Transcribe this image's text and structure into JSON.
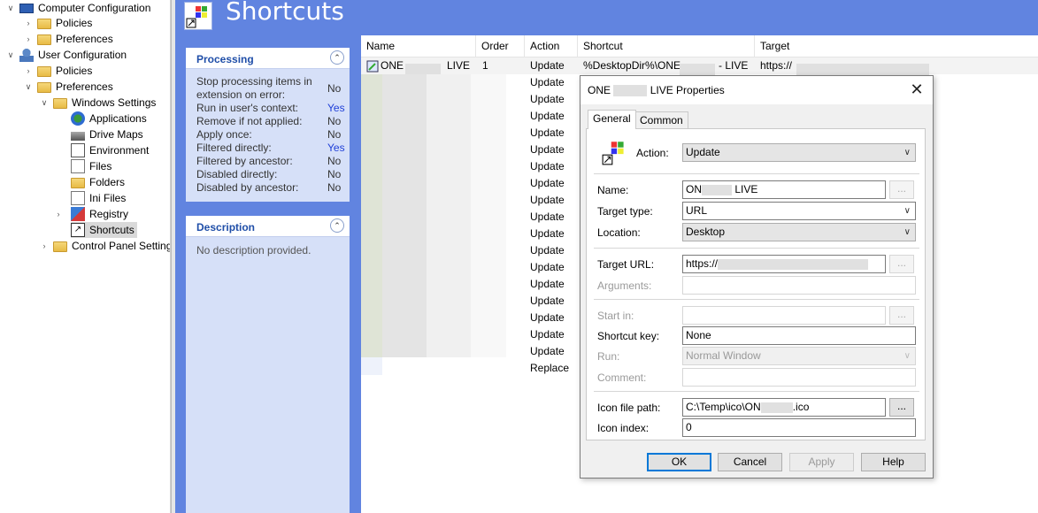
{
  "tree": {
    "computer_configuration": "Computer Configuration",
    "cc_policies": "Policies",
    "cc_preferences": "Preferences",
    "user_configuration": "User Configuration",
    "uc_policies": "Policies",
    "uc_preferences": "Preferences",
    "windows_settings": "Windows Settings",
    "applications": "Applications",
    "drive_maps": "Drive Maps",
    "environment": "Environment",
    "files": "Files",
    "folders": "Folders",
    "ini_files": "Ini Files",
    "registry": "Registry",
    "shortcuts": "Shortcuts",
    "control_panel_settings": "Control Panel Setting"
  },
  "header": {
    "title": "Shortcuts"
  },
  "processing": {
    "title": "Processing",
    "rows": [
      {
        "k": "Stop processing items in",
        "v": ""
      },
      {
        "k": "extension on error:",
        "v": "No"
      },
      {
        "k": "Run in user's context:",
        "v": "Yes"
      },
      {
        "k": "Remove if not applied:",
        "v": "No"
      },
      {
        "k": "Apply once:",
        "v": "No"
      },
      {
        "k": "Filtered directly:",
        "v": "Yes"
      },
      {
        "k": "Filtered by ancestor:",
        "v": "No"
      },
      {
        "k": "Disabled directly:",
        "v": "No"
      },
      {
        "k": "Disabled by ancestor:",
        "v": "No"
      }
    ]
  },
  "description": {
    "title": "Description",
    "text": "No description provided."
  },
  "list": {
    "columns": {
      "name": "Name",
      "order": "Order",
      "action": "Action",
      "shortcut": "Shortcut",
      "target": "Target"
    },
    "first_row": {
      "name_prefix": "ONE",
      "name_suffix": "LIVE",
      "order": "1",
      "action": "Update",
      "shortcut_prefix": "%DesktopDir%\\ONE",
      "shortcut_suffix": "- LIVE",
      "target": "https://"
    },
    "actions": [
      "Update",
      "Update",
      "Update",
      "Update",
      "Update",
      "Update",
      "Update",
      "Update",
      "Update",
      "Update",
      "Update",
      "Update",
      "Update",
      "Update",
      "Update",
      "Update",
      "Update",
      "Replace"
    ]
  },
  "dialog": {
    "title_prefix": "ONE",
    "title_suffix": "LIVE Properties",
    "tabs": {
      "general": "General",
      "common": "Common"
    },
    "action_label": "Action:",
    "action_value": "Update",
    "name_label": "Name:",
    "name_prefix": "ON",
    "name_suffix": "LIVE",
    "target_type_label": "Target type:",
    "target_type_value": "URL",
    "location_label": "Location:",
    "location_value": "Desktop",
    "target_url_label": "Target URL:",
    "target_url_value": "https://",
    "arguments_label": "Arguments:",
    "start_in_label": "Start in:",
    "shortcut_key_label": "Shortcut key:",
    "shortcut_key_value": "None",
    "run_label": "Run:",
    "run_value": "Normal Window",
    "comment_label": "Comment:",
    "icon_path_label": "Icon file path:",
    "icon_path_prefix": "C:\\Temp\\ico\\ON",
    "icon_path_suffix": ".ico",
    "icon_index_label": "Icon index:",
    "icon_index_value": "0",
    "ellipsis": "...",
    "buttons": {
      "ok": "OK",
      "cancel": "Cancel",
      "apply": "Apply",
      "help": "Help"
    }
  }
}
